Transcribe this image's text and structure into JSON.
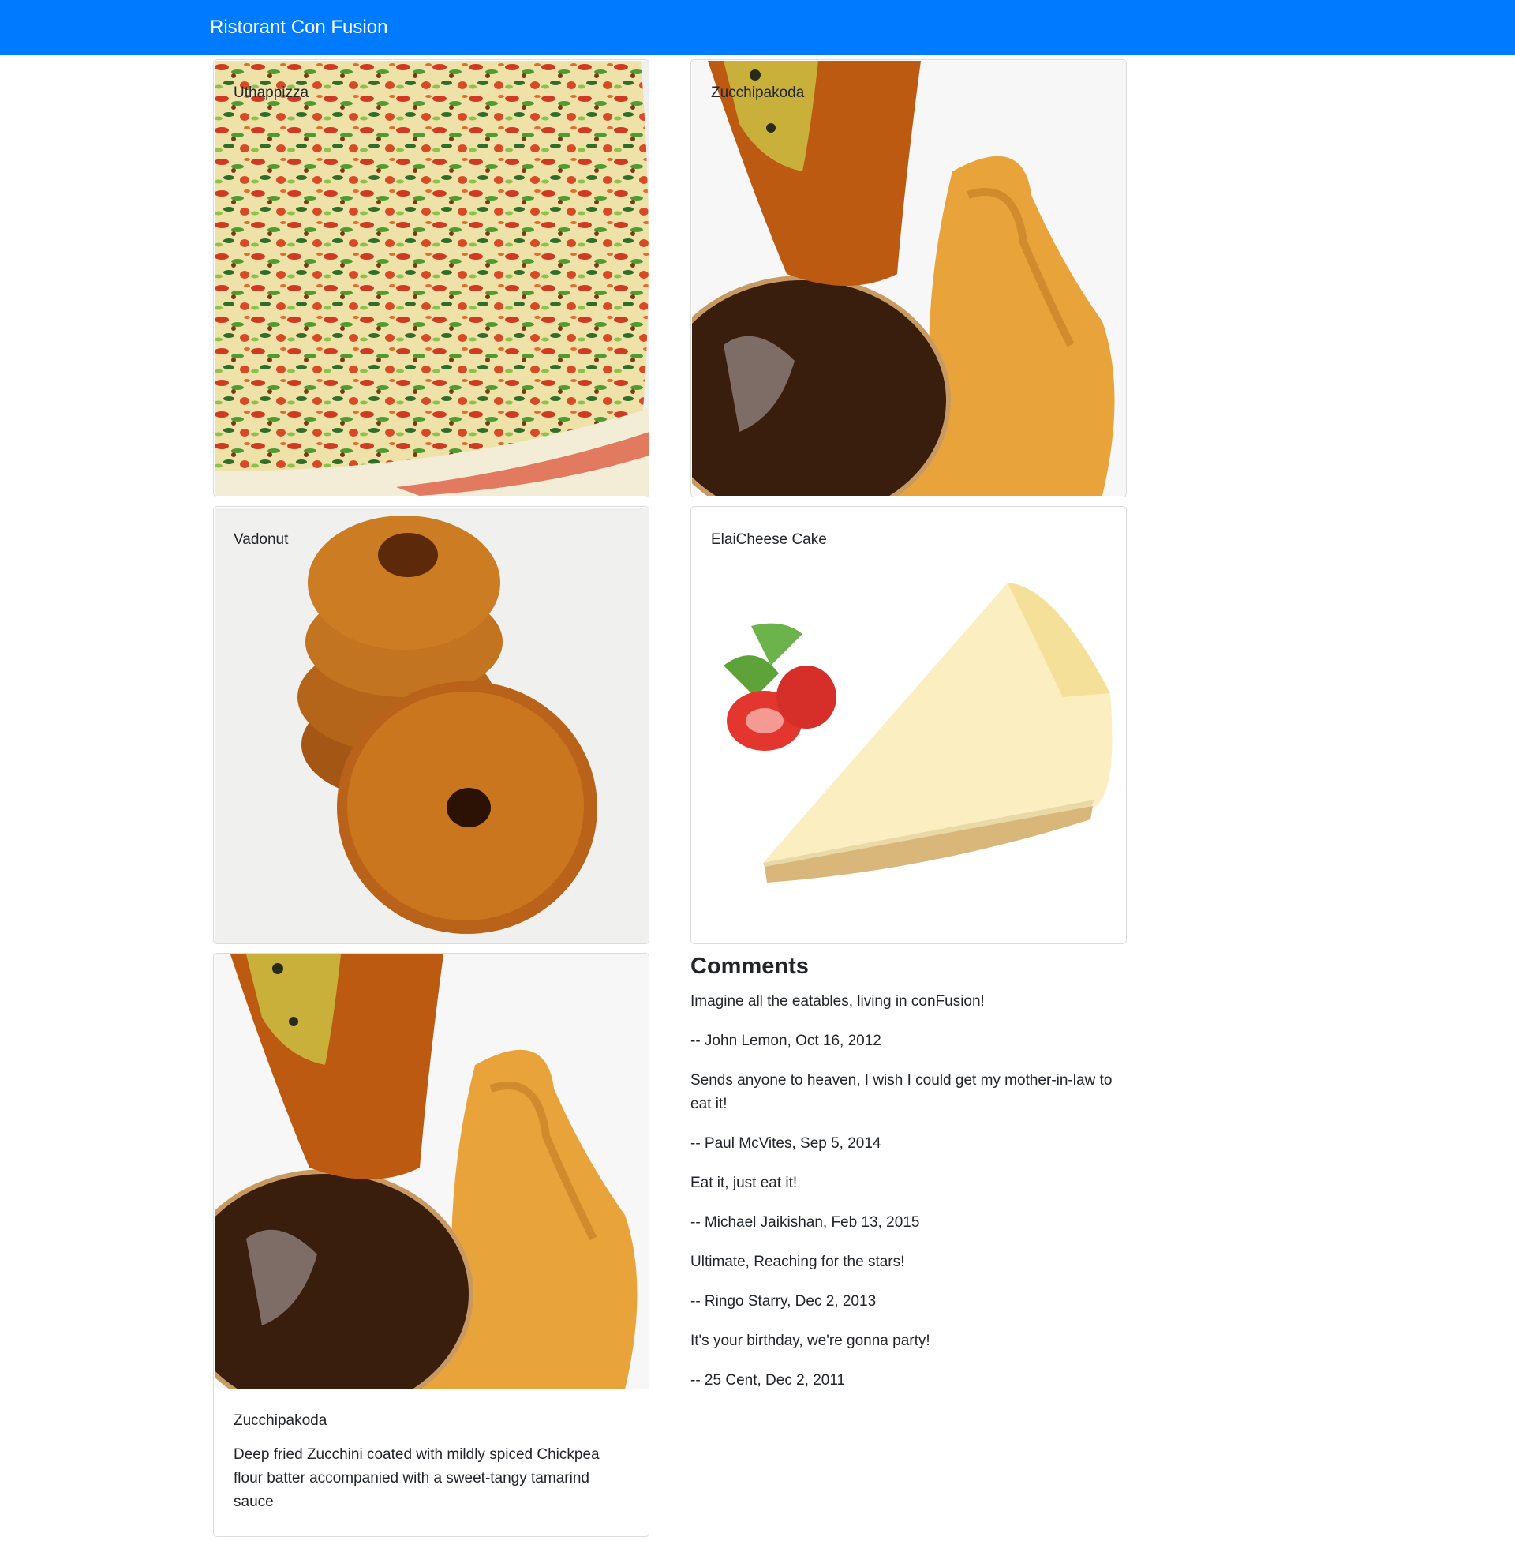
{
  "navbar": {
    "brand": "Ristorant Con Fusion"
  },
  "dishes": [
    {
      "name": "Uthappizza",
      "image": "uthappizza-image"
    },
    {
      "name": "Zucchipakoda",
      "image": "zucchipakoda-image"
    },
    {
      "name": "Vadonut",
      "image": "vadonut-image"
    },
    {
      "name": "ElaiCheese Cake",
      "image": "elaicheese-cake-image"
    }
  ],
  "selected_dish": {
    "name": "Zucchipakoda",
    "description": "Deep fried Zucchini coated with mildly spiced Chickpea flour batter accompanied with a sweet-tangy tamarind sauce",
    "image": "zucchipakoda-image"
  },
  "comments": {
    "heading": "Comments",
    "items": [
      {
        "text": "Imagine all the eatables, living in conFusion!",
        "byline": "-- John Lemon, Oct 16, 2012"
      },
      {
        "text": "Sends anyone to heaven, I wish I could get my mother-in-law to eat it!",
        "byline": "-- Paul McVites, Sep 5, 2014"
      },
      {
        "text": "Eat it, just eat it!",
        "byline": "-- Michael Jaikishan, Feb 13, 2015"
      },
      {
        "text": "Ultimate, Reaching for the stars!",
        "byline": "-- Ringo Starry, Dec 2, 2013"
      },
      {
        "text": "It's your birthday, we're gonna party!",
        "byline": "-- 25 Cent, Dec 2, 2011"
      }
    ]
  }
}
